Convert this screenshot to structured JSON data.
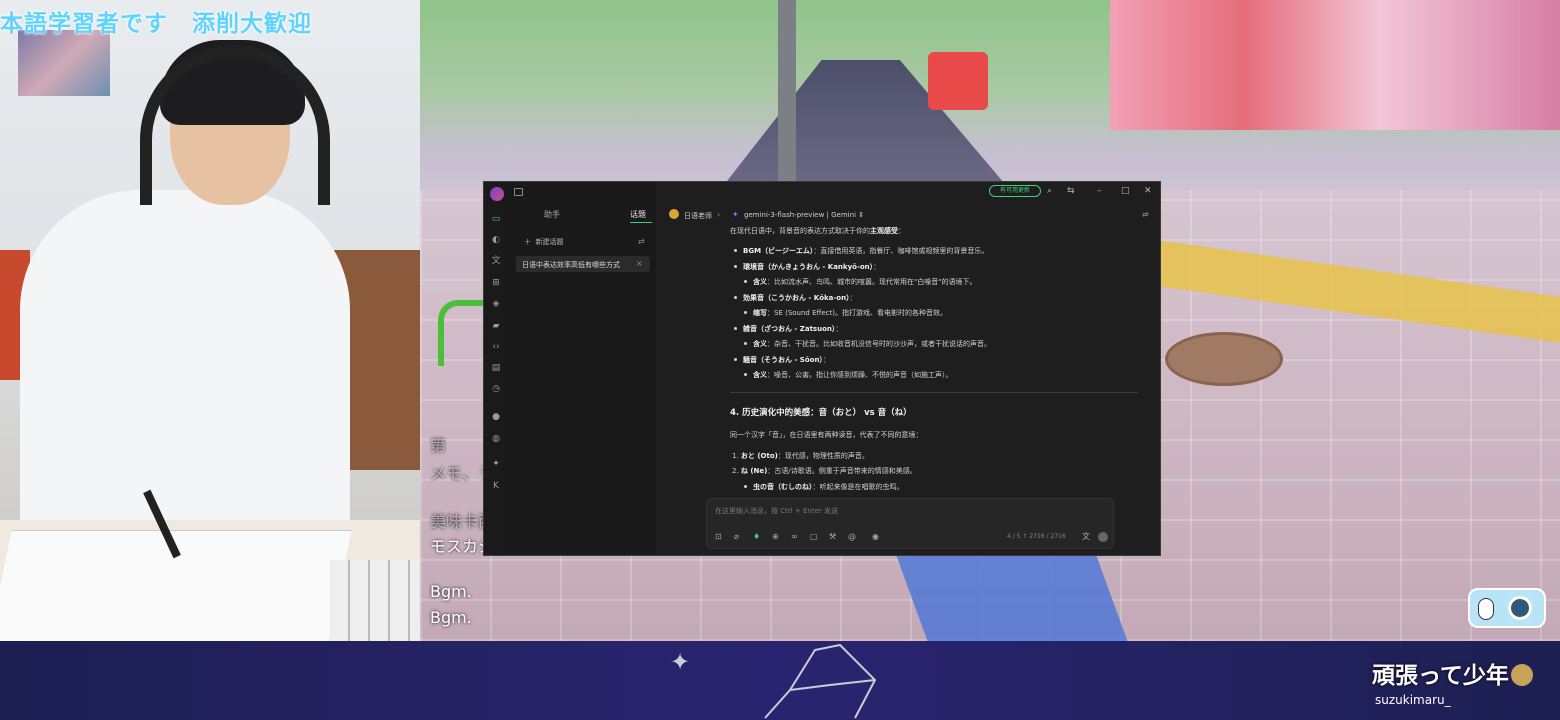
{
  "stream": {
    "cam_title": "本語学習者です　添削大歓迎",
    "subtitles": [
      "第",
      "メモ、うーん",
      "美味卡西。",
      "モスカシ。",
      "Bgm.",
      "Bgm."
    ],
    "slogan": "頑張って少年",
    "handle": "suzukimaru_"
  },
  "app": {
    "update_pill": "有可用更新",
    "top_icons": [
      "search-icon",
      "layout-icon",
      "minimize-icon",
      "maximize-icon",
      "close-icon"
    ],
    "rail_icons": [
      "chat-icon",
      "palette-icon",
      "translate-icon",
      "apps-icon",
      "knowledge-icon",
      "folder-icon",
      "code-icon",
      "notes-icon",
      "clock-icon",
      "planet-icon",
      "globe-icon",
      "sparkle-icon",
      "k-icon"
    ],
    "tabs": {
      "assistant": "助手",
      "topics": "话题"
    },
    "new_topic": "新建话题",
    "topic_item": "日语中表达效率高低有哪些方式",
    "header": {
      "assistant_name": "日语老师",
      "model": "gemini-3-flash-preview | Gemini"
    },
    "content": {
      "intro": "在现代日语中，背景音的表达方式取决于你的",
      "intro_bold": "主观感受",
      "intro_end": "：",
      "b1_term": "BGM（ビージーエム）",
      "b1_text": "：直接借用英语，指餐厅、咖啡馆或视频里的背景音乐。",
      "b2_term": "環境音（かんきょうおん - Kankyō-on）",
      "b2_end": "：",
      "b2_sub_term": "含义",
      "b2_sub_text": "：比如流水声、鸟鸣、城市的喧嚣。现代常用在\"白噪音\"的语境下。",
      "b3_term": "効果音（こうかおん - Kōka-on）",
      "b3_end": "：",
      "b3_sub_term": "缩写",
      "b3_sub_text": "：SE (Sound Effect)。指打游戏、看电影时的各种音效。",
      "b4_term": "雑音（ざつおん - Zatsuon）",
      "b4_end": "：",
      "b4_sub_term": "含义",
      "b4_sub_text": "：杂音、干扰音。比如收音机没信号时的沙沙声，或者干扰说话的声音。",
      "b5_term": "騒音（そうおん - Sōon）",
      "b5_end": "：",
      "b5_sub_term": "含义",
      "b5_sub_text": "：噪音、公害。指让你感到烦躁、不悦的声音（如施工声）。",
      "h4": "4. 历史演化中的美感：音（おと） vs 音（ね）",
      "p4": "同一个汉字「音」，在日语里有两种读音，代表了不同的意境：",
      "n1_term": "おと (Oto)",
      "n1_text": "：现代感，物理性质的声音。",
      "n2_term": "ね (Ne)",
      "n2_text": "：古语/诗歌语。侧重于声音带来的情感和美感。",
      "n2_sub_term": "虫の音（むしのね）",
      "n2_sub_text": "：听起来像是在唱歌的虫鸣。"
    },
    "input": {
      "placeholder": "在这里输入消息，按 Ctrl + Enter 发送",
      "count": "4 / 5  ↑ 2716 / 2716"
    },
    "colors": {
      "accent": "#3ecf7a",
      "panel": "#1e1e1e"
    }
  }
}
